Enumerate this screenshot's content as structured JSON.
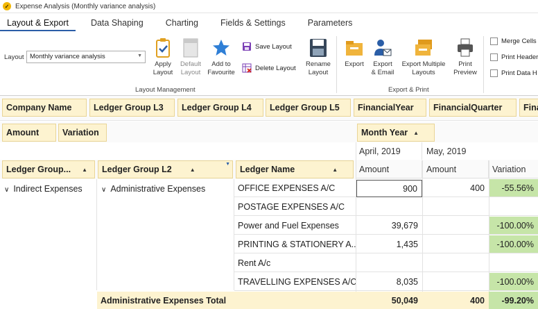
{
  "window": {
    "title": "Expense Analysis (Monthly variance analysis)"
  },
  "tabs": [
    "Layout & Export",
    "Data Shaping",
    "Charting",
    "Fields & Settings",
    "Parameters"
  ],
  "ribbon": {
    "layout_label": "Layout",
    "layout_value": "Monthly variance analysis",
    "apply_layout": "Apply\nLayout",
    "default_layout": "Default\nLayout",
    "add_favourite": "Add to\nFavourite",
    "save_layout": "Save Layout",
    "delete_layout": "Delete Layout",
    "rename_layout": "Rename\nLayout",
    "layout_management": "Layout Management",
    "export": "Export",
    "export_email": "Export\n& Email",
    "export_multiple": "Export Multiple\nLayouts",
    "print_preview": "Print\nPreview",
    "export_print": "Export & Print",
    "merge_cells": "Merge Cells",
    "print_header": "Print Header",
    "print_data": "Print Data H"
  },
  "filter_fields": [
    "Company Name",
    "Ledger Group L3",
    "Ledger Group L4",
    "Ledger Group L5",
    "FinancialYear",
    "FinancialQuarter",
    "Fina"
  ],
  "data_fields": [
    "Amount",
    "Variation"
  ],
  "column_field": "Month Year",
  "row_fields": [
    "Ledger Group...",
    "Ledger Group L2",
    "Ledger Name"
  ],
  "months": [
    "April, 2019",
    "May, 2019"
  ],
  "value_headers": [
    "Amount",
    "Amount",
    "Variation"
  ],
  "group_l1": "Indirect Expenses",
  "group_l2": "Administrative Expenses",
  "rows": [
    {
      "name": "OFFICE EXPENSES A/C",
      "april": "900",
      "may": "400",
      "variation": "-55.56%"
    },
    {
      "name": "POSTAGE EXPENSES A/C",
      "april": "",
      "may": "",
      "variation": ""
    },
    {
      "name": "Power and Fuel Expenses",
      "april": "39,679",
      "may": "",
      "variation": "-100.00%"
    },
    {
      "name": "PRINTING & STATIONERY A...",
      "april": "1,435",
      "may": "",
      "variation": "-100.00%"
    },
    {
      "name": "Rent A/c",
      "april": "",
      "may": "",
      "variation": ""
    },
    {
      "name": "TRAVELLING EXPENSES A/C",
      "april": "8,035",
      "may": "",
      "variation": "-100.00%"
    }
  ],
  "total": {
    "label": "Administrative Expenses Total",
    "april": "50,049",
    "may": "400",
    "variation": "-99.20%"
  },
  "colors": {
    "field_chip": "#fdf3d0",
    "variation_fill": "#c6e5a8",
    "tab_accent": "#2b5ea7"
  }
}
